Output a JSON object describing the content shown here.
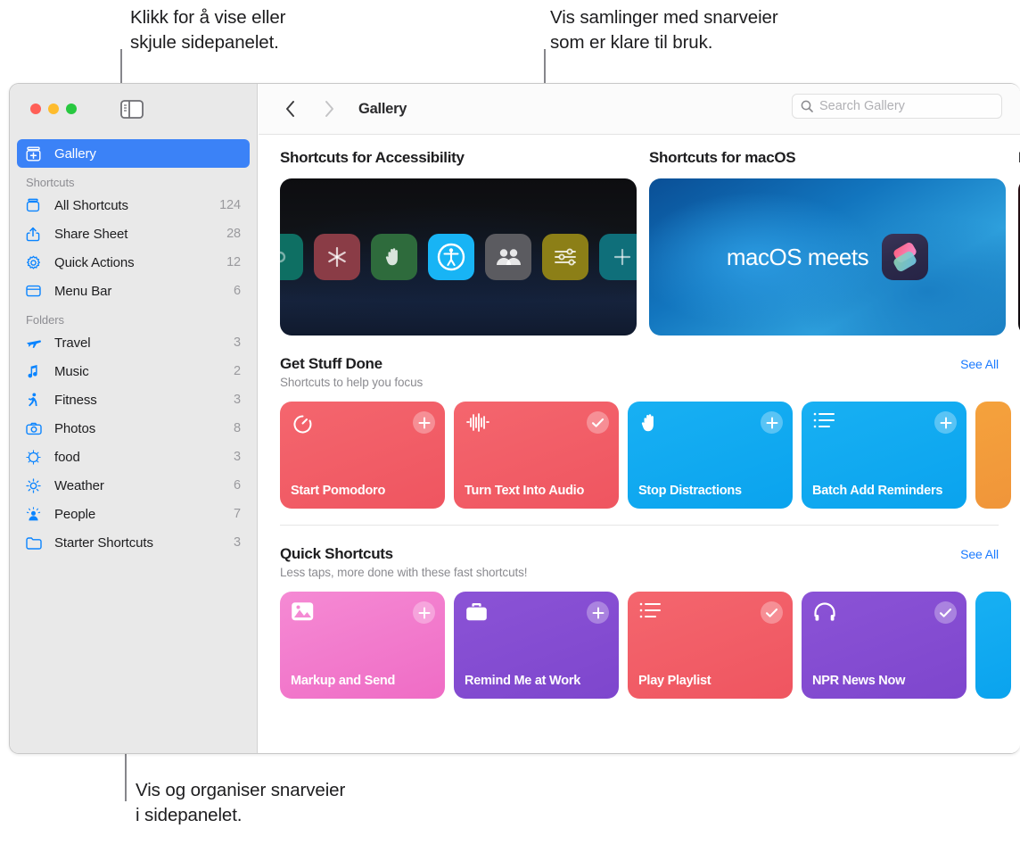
{
  "callouts": [
    {
      "id": "sidebar-toggle-callout",
      "text": "Klikk for å vise eller\nskjule sidepanelet."
    },
    {
      "id": "gallery-callout",
      "text": "Vis samlinger med snarveier\nsom er klare til bruk."
    },
    {
      "id": "organize-callout",
      "text": "Vis og organiser snarveier\ni sidepanelet."
    }
  ],
  "window": {
    "traffic_lights": [
      "close",
      "minimize",
      "zoom"
    ],
    "sidebar_toggle_icon": "sidebar-toggle-icon"
  },
  "sidebar": {
    "primary": [
      {
        "label": "Gallery",
        "icon": "gallery-icon",
        "count": "",
        "selected": true
      }
    ],
    "sections": [
      {
        "header": "Shortcuts",
        "items": [
          {
            "label": "All Shortcuts",
            "icon": "shortcuts-stack-icon",
            "count": "124"
          },
          {
            "label": "Share Sheet",
            "icon": "share-icon",
            "count": "28"
          },
          {
            "label": "Quick Actions",
            "icon": "gear-icon",
            "count": "12"
          },
          {
            "label": "Menu Bar",
            "icon": "menubar-icon",
            "count": "6"
          }
        ]
      },
      {
        "header": "Folders",
        "items": [
          {
            "label": "Travel",
            "icon": "airplane-icon",
            "count": "3"
          },
          {
            "label": "Music",
            "icon": "music-note-icon",
            "count": "2"
          },
          {
            "label": "Fitness",
            "icon": "runner-icon",
            "count": "3"
          },
          {
            "label": "Photos",
            "icon": "camera-icon",
            "count": "8"
          },
          {
            "label": "food",
            "icon": "sparkle-ring-icon",
            "count": "3"
          },
          {
            "label": "Weather",
            "icon": "sun-icon",
            "count": "6"
          },
          {
            "label": "People",
            "icon": "person-icon",
            "count": "7"
          },
          {
            "label": "Starter Shortcuts",
            "icon": "folder-icon",
            "count": "3"
          }
        ]
      }
    ]
  },
  "toolbar": {
    "back_icon": "chevron-left-icon",
    "forward_icon": "chevron-right-icon",
    "breadcrumb": "Gallery",
    "search_icon": "search-icon",
    "search_placeholder": "Search Gallery",
    "search_value": ""
  },
  "banners": [
    {
      "title": "Shortcuts for Accessibility",
      "kind": "accessibility",
      "text": ""
    },
    {
      "title": "Shortcuts for macOS",
      "kind": "macos",
      "text": "macOS meets"
    },
    {
      "title": "F",
      "kind": "dark-peek",
      "text": ""
    }
  ],
  "accessibility_icons": [
    {
      "name": "switch-control-icon",
      "color": "#0e6f63"
    },
    {
      "name": "assistive-touch-icon",
      "color": "#8a3c46"
    },
    {
      "name": "hand-raise-icon",
      "color": "#2e6b3c"
    },
    {
      "name": "accessibility-icon",
      "color": "#18b4f5"
    },
    {
      "name": "people-icon",
      "color": "#5b5b60"
    },
    {
      "name": "sliders-icon",
      "color": "#8c7f17"
    },
    {
      "name": "sparkle-icon",
      "color": "#0f6f7a"
    }
  ],
  "sections": [
    {
      "title": "Get Stuff Done",
      "subtitle": "Shortcuts to help you focus",
      "see_all": "See All",
      "cards": [
        {
          "name": "Start Pomodoro",
          "icon": "timer-icon",
          "badge": "plus",
          "color_a": "#f4666e",
          "color_b": "#ef5560"
        },
        {
          "name": "Turn Text Into Audio",
          "icon": "waveform-icon",
          "badge": "check",
          "color_a": "#f4666e",
          "color_b": "#ef5560"
        },
        {
          "name": "Stop Distractions",
          "icon": "hand-raise-icon",
          "badge": "plus",
          "color_a": "#18b0f3",
          "color_b": "#0aa3ee"
        },
        {
          "name": "Batch Add Reminders",
          "icon": "list-icon",
          "badge": "plus",
          "color_a": "#18b0f3",
          "color_b": "#0aa3ee"
        },
        {
          "name": "",
          "icon": "",
          "badge": "",
          "color_a": "#f5a23c",
          "color_b": "#f0953a"
        }
      ]
    },
    {
      "title": "Quick Shortcuts",
      "subtitle": "Less taps, more done with these fast shortcuts!",
      "see_all": "See All",
      "cards": [
        {
          "name": "Markup and Send",
          "icon": "photo-icon",
          "badge": "plus",
          "color_a": "#f57fcf",
          "color_b": "#ef6cc5"
        },
        {
          "name": "Remind Me at Work",
          "icon": "briefcase-icon",
          "badge": "plus",
          "color_a": "#8b53d6",
          "color_b": "#7e46cd"
        },
        {
          "name": "Play Playlist",
          "icon": "list-icon",
          "badge": "check",
          "color_a": "#f4666e",
          "color_b": "#ef5560"
        },
        {
          "name": "NPR News Now",
          "icon": "headphones-icon",
          "badge": "check",
          "color_a": "#8b53d6",
          "color_b": "#7e46cd"
        },
        {
          "name": "",
          "icon": "",
          "badge": "",
          "color_a": "#18b0f3",
          "color_b": "#0aa3ee"
        }
      ]
    }
  ],
  "colors": {
    "accent": "#0a84ff",
    "selection": "#3b82f7",
    "link": "#1a7aff",
    "sidebar_bg": "#e9e9e9",
    "count_text": "#9a9a9e"
  }
}
